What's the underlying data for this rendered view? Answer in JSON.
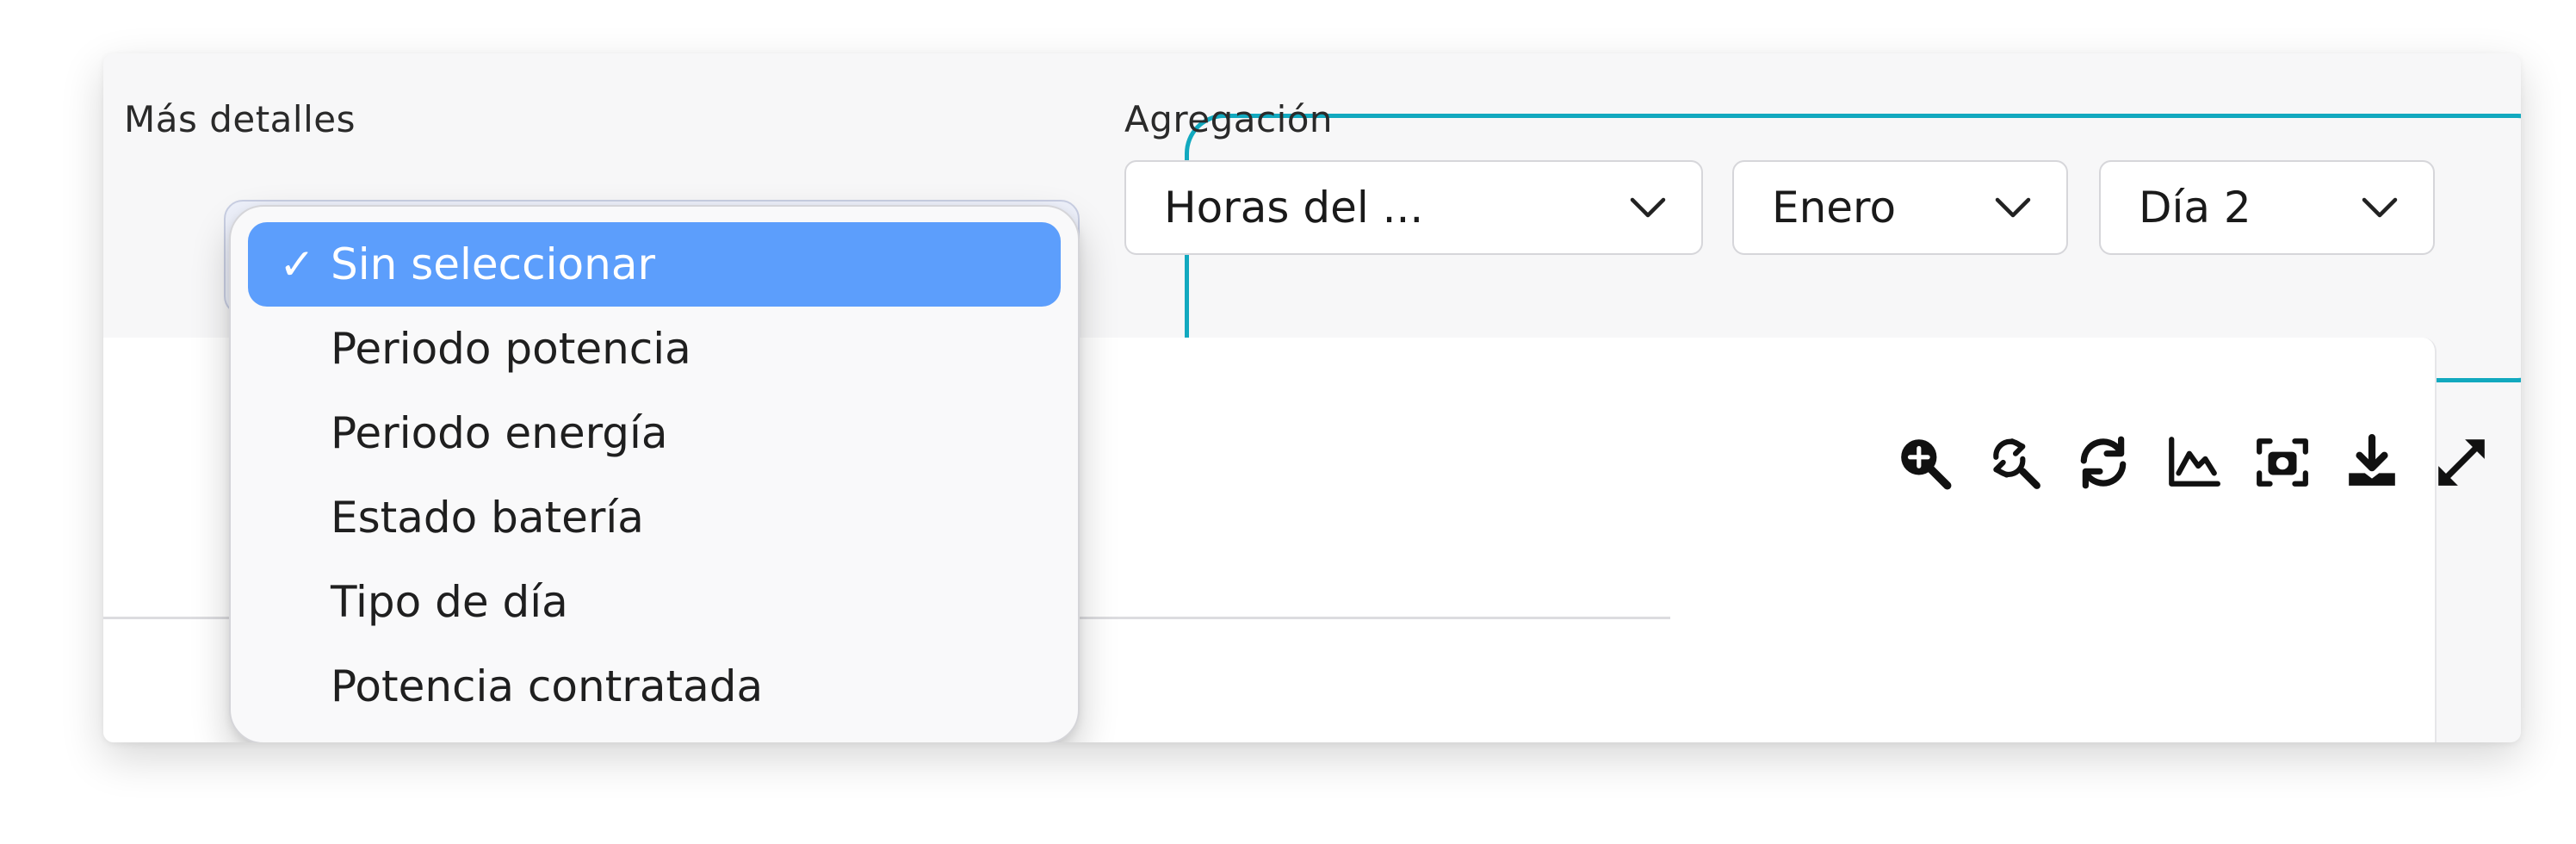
{
  "details": {
    "label": "Más detalles",
    "options": [
      {
        "label": "Sin seleccionar",
        "selected": true,
        "check": "✓"
      },
      {
        "label": "Periodo potencia",
        "selected": false,
        "check": ""
      },
      {
        "label": "Periodo energía",
        "selected": false,
        "check": ""
      },
      {
        "label": "Estado batería",
        "selected": false,
        "check": ""
      },
      {
        "label": "Tipo de día",
        "selected": false,
        "check": ""
      },
      {
        "label": "Potencia contratada",
        "selected": false,
        "check": ""
      }
    ]
  },
  "aggregation": {
    "label": "Agregación",
    "selects": [
      {
        "value": "Horas del ..."
      },
      {
        "value": "Enero"
      },
      {
        "value": "Día 2"
      }
    ]
  },
  "toolbar": {
    "icons": [
      "zoom-in-icon",
      "zoom-reset-icon",
      "refresh-icon",
      "chart-icon",
      "screenshot-icon",
      "download-icon",
      "fullscreen-icon"
    ]
  },
  "colors": {
    "accent": "#12a9bf",
    "selected_option": "#5c9efc"
  }
}
